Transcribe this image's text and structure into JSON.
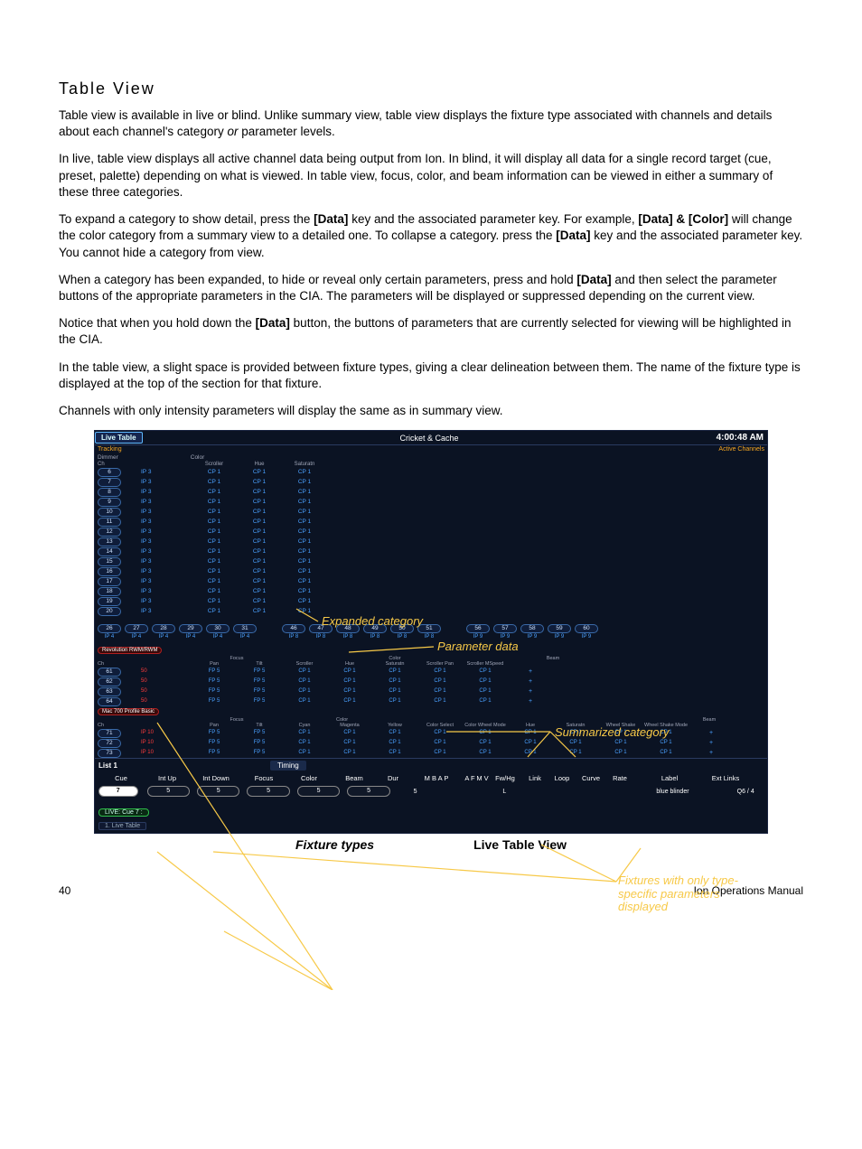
{
  "page": {
    "heading": "Table View",
    "p1a": "Table view is available in live or blind. Unlike summary view, table view displays the fixture type associated with channels and details about each channel's category ",
    "p1b": "or",
    "p1c": " parameter levels.",
    "p2": "In live, table view displays all active channel data being output from Ion. In blind, it will display all data for a single record target (cue, preset, palette) depending on what is viewed. In table view, focus, color, and beam information can be viewed in either a summary of these three categories.",
    "p3a": "To expand a category to show detail, press the ",
    "p3b": "[Data]",
    "p3c": " key and the associated parameter key. For example, ",
    "p3d": "[Data] & [Color]",
    "p3e": " will change the color category from a summary view to a detailed one. To collapse a category. press the ",
    "p3f": "[Data]",
    "p3g": " key and the associated parameter key. You cannot hide a category from view.",
    "p4a": "When a category has been expanded, to hide or reveal only certain parameters, press and hold ",
    "p4b": "[Data]",
    "p4c": " and then select the parameter buttons of the appropriate parameters in the CIA. The parameters will be displayed or suppressed depending on the current view.",
    "p5a": "Notice that when you hold down the ",
    "p5b": "[Data]",
    "p5c": " button, the buttons of parameters that are currently selected for viewing will be highlighted in the CIA.",
    "p6": "In the table view, a slight space is provided between fixture types, giving a clear delineation between them. The name of the fixture type is displayed at the top of the section for that fixture.",
    "p7": "Channels with only intensity parameters will display the same as in summary view."
  },
  "screen": {
    "tab": "Live Table",
    "title": "Cricket & Cache",
    "clock": "4:00:48 AM",
    "tracking": "Tracking",
    "active": "Active Channels",
    "dimmer": {
      "group_labels": {
        "a": "Dimmer",
        "b": "Color"
      },
      "sub": {
        "ch": "Ch",
        "scroller": "Scroller",
        "hue": "Hue",
        "saturatn": "Saturatn"
      },
      "rows": [
        {
          "ch": "6",
          "ip": "IP 3",
          "c1": "CP 1",
          "c2": "CP 1",
          "c3": "CP 1"
        },
        {
          "ch": "7",
          "ip": "IP 3",
          "c1": "CP 1",
          "c2": "CP 1",
          "c3": "CP 1"
        },
        {
          "ch": "8",
          "ip": "IP 3",
          "c1": "CP 1",
          "c2": "CP 1",
          "c3": "CP 1"
        },
        {
          "ch": "9",
          "ip": "IP 3",
          "c1": "CP 1",
          "c2": "CP 1",
          "c3": "CP 1"
        },
        {
          "ch": "10",
          "ip": "IP 3",
          "c1": "CP 1",
          "c2": "CP 1",
          "c3": "CP 1"
        },
        {
          "ch": "11",
          "ip": "IP 3",
          "c1": "CP 1",
          "c2": "CP 1",
          "c3": "CP 1"
        },
        {
          "ch": "12",
          "ip": "IP 3",
          "c1": "CP 1",
          "c2": "CP 1",
          "c3": "CP 1"
        },
        {
          "ch": "13",
          "ip": "IP 3",
          "c1": "CP 1",
          "c2": "CP 1",
          "c3": "CP 1"
        },
        {
          "ch": "14",
          "ip": "IP 3",
          "c1": "CP 1",
          "c2": "CP 1",
          "c3": "CP 1"
        },
        {
          "ch": "15",
          "ip": "IP 3",
          "c1": "CP 1",
          "c2": "CP 1",
          "c3": "CP 1"
        },
        {
          "ch": "16",
          "ip": "IP 3",
          "c1": "CP 1",
          "c2": "CP 1",
          "c3": "CP 1"
        },
        {
          "ch": "17",
          "ip": "IP 3",
          "c1": "CP 1",
          "c2": "CP 1",
          "c3": "CP 1"
        },
        {
          "ch": "18",
          "ip": "IP 3",
          "c1": "CP 1",
          "c2": "CP 1",
          "c3": "CP 1"
        },
        {
          "ch": "19",
          "ip": "IP 3",
          "c1": "CP 1",
          "c2": "CP 1",
          "c3": "CP 1"
        },
        {
          "ch": "20",
          "ip": "IP 3",
          "c1": "CP 1",
          "c2": "CP 1",
          "c3": "CP 1"
        }
      ]
    },
    "strip": {
      "left": [
        {
          "ch": "26",
          "v": "IP 4"
        },
        {
          "ch": "27",
          "v": "IP 4"
        },
        {
          "ch": "28",
          "v": "IP 4"
        },
        {
          "ch": "29",
          "v": "IP 4"
        },
        {
          "ch": "30",
          "v": "IP 4"
        },
        {
          "ch": "31",
          "v": "IP 4"
        }
      ],
      "mid": [
        {
          "ch": "46",
          "v": "IP 8"
        },
        {
          "ch": "47",
          "v": "IP 8"
        },
        {
          "ch": "48",
          "v": "IP 8"
        },
        {
          "ch": "49",
          "v": "IP 8"
        },
        {
          "ch": "50",
          "v": "IP 8"
        },
        {
          "ch": "51",
          "v": "IP 8"
        }
      ],
      "right": [
        {
          "ch": "56",
          "v": "IP 9"
        },
        {
          "ch": "57",
          "v": "IP 9"
        },
        {
          "ch": "58",
          "v": "IP 9"
        },
        {
          "ch": "59",
          "v": "IP 9"
        },
        {
          "ch": "60",
          "v": "IP 9"
        }
      ]
    },
    "rev": {
      "fixlabel": "Revolution RWM/RWM",
      "heads": {
        "focus": "Focus",
        "color": "Color",
        "beam": "Beam"
      },
      "sub": {
        "ch": "Ch",
        "pan": "Pan",
        "tilt": "Tilt",
        "scroller": "Scroller",
        "hue": "Hue",
        "saturatn": "Saturatn",
        "spun": "Scroller Pan",
        "smspeed": "Scroller MSpeed"
      },
      "rows": [
        {
          "ch": "61",
          "int": "50",
          "p": "FP 5",
          "t": "FP 5",
          "a": "CP 1",
          "b": "CP 1",
          "c": "CP 1",
          "d": "CP 1",
          "e": "CP 1",
          "bm": "+"
        },
        {
          "ch": "62",
          "int": "50",
          "p": "FP 5",
          "t": "FP 5",
          "a": "CP 1",
          "b": "CP 1",
          "c": "CP 1",
          "d": "CP 1",
          "e": "CP 1",
          "bm": "+"
        },
        {
          "ch": "63",
          "int": "50",
          "p": "FP 5",
          "t": "FP 5",
          "a": "CP 1",
          "b": "CP 1",
          "c": "CP 1",
          "d": "CP 1",
          "e": "CP 1",
          "bm": "+"
        },
        {
          "ch": "64",
          "int": "50",
          "p": "FP 5",
          "t": "FP 5",
          "a": "CP 1",
          "b": "CP 1",
          "c": "CP 1",
          "d": "CP 1",
          "e": "CP 1",
          "bm": "+"
        }
      ]
    },
    "mac": {
      "fixlabel": "Mac 700 Profile Basic",
      "heads": {
        "focus": "Focus",
        "color": "Color",
        "beam": "Beam"
      },
      "sub": {
        "ch": "Ch",
        "pan": "Pan",
        "tilt": "Tilt",
        "cyan": "Cyan",
        "magenta": "Magenta",
        "yellow": "Yellow",
        "csel": "Color Select",
        "cwm": "Color Wheel Mode",
        "hue": "Hue",
        "sat": "Saturatn",
        "ws": "Wheel Shake",
        "wsm": "Wheel Shake Mode"
      },
      "rows": [
        {
          "ch": "71",
          "int": "IP 10",
          "p": "FP 5",
          "t": "FP 5",
          "a": "CP 1",
          "b": "CP 1",
          "c": "CP 1",
          "d": "CP 1",
          "e": "CP 1",
          "f": "CP 1",
          "g": "CP 1",
          "h": "CP 1",
          "i": "CP 1",
          "bm": "+"
        },
        {
          "ch": "72",
          "int": "IP 10",
          "p": "FP 5",
          "t": "FP 5",
          "a": "CP 1",
          "b": "CP 1",
          "c": "CP 1",
          "d": "CP 1",
          "e": "CP 1",
          "f": "CP 1",
          "g": "CP 1",
          "h": "CP 1",
          "i": "CP 1",
          "bm": "+"
        },
        {
          "ch": "73",
          "int": "IP 10",
          "p": "FP 5",
          "t": "FP 5",
          "a": "CP 1",
          "b": "CP 1",
          "c": "CP 1",
          "d": "CP 1",
          "e": "CP 1",
          "f": "CP 1",
          "g": "CP 1",
          "h": "CP 1",
          "i": "CP 1",
          "bm": "+"
        }
      ]
    },
    "list": {
      "name": "List 1",
      "timing": "Timing",
      "heads": [
        "Cue",
        "Int Up",
        "Int Down",
        "Focus",
        "Color",
        "Beam",
        "Dur",
        "M B A P",
        "A F",
        "M V",
        "Fw/Hg",
        "Link",
        "Loop",
        "Curve",
        "Rate",
        "Label",
        "Ext Links"
      ],
      "row": {
        "cue": "7",
        "up": "5",
        "down": "5",
        "focus": "5",
        "color": "5",
        "beam": "5",
        "dur": "5",
        "flags": "L",
        "label": "blue blinder",
        "ext": "Q6 / 4"
      }
    },
    "footer": {
      "live": "LIVE: Cue  7 :",
      "tab": "1. Live Table"
    }
  },
  "annotations": {
    "expanded": "Expanded category",
    "paramdata": "Parameter data",
    "summarized": "Summarized category",
    "fixtures_only": "Fixtures with only type-specific parameters displayed"
  },
  "captions": {
    "left": "Fixture types",
    "right": "Live Table View"
  },
  "footer": {
    "pagenum": "40",
    "manual": "Ion Operations Manual"
  }
}
